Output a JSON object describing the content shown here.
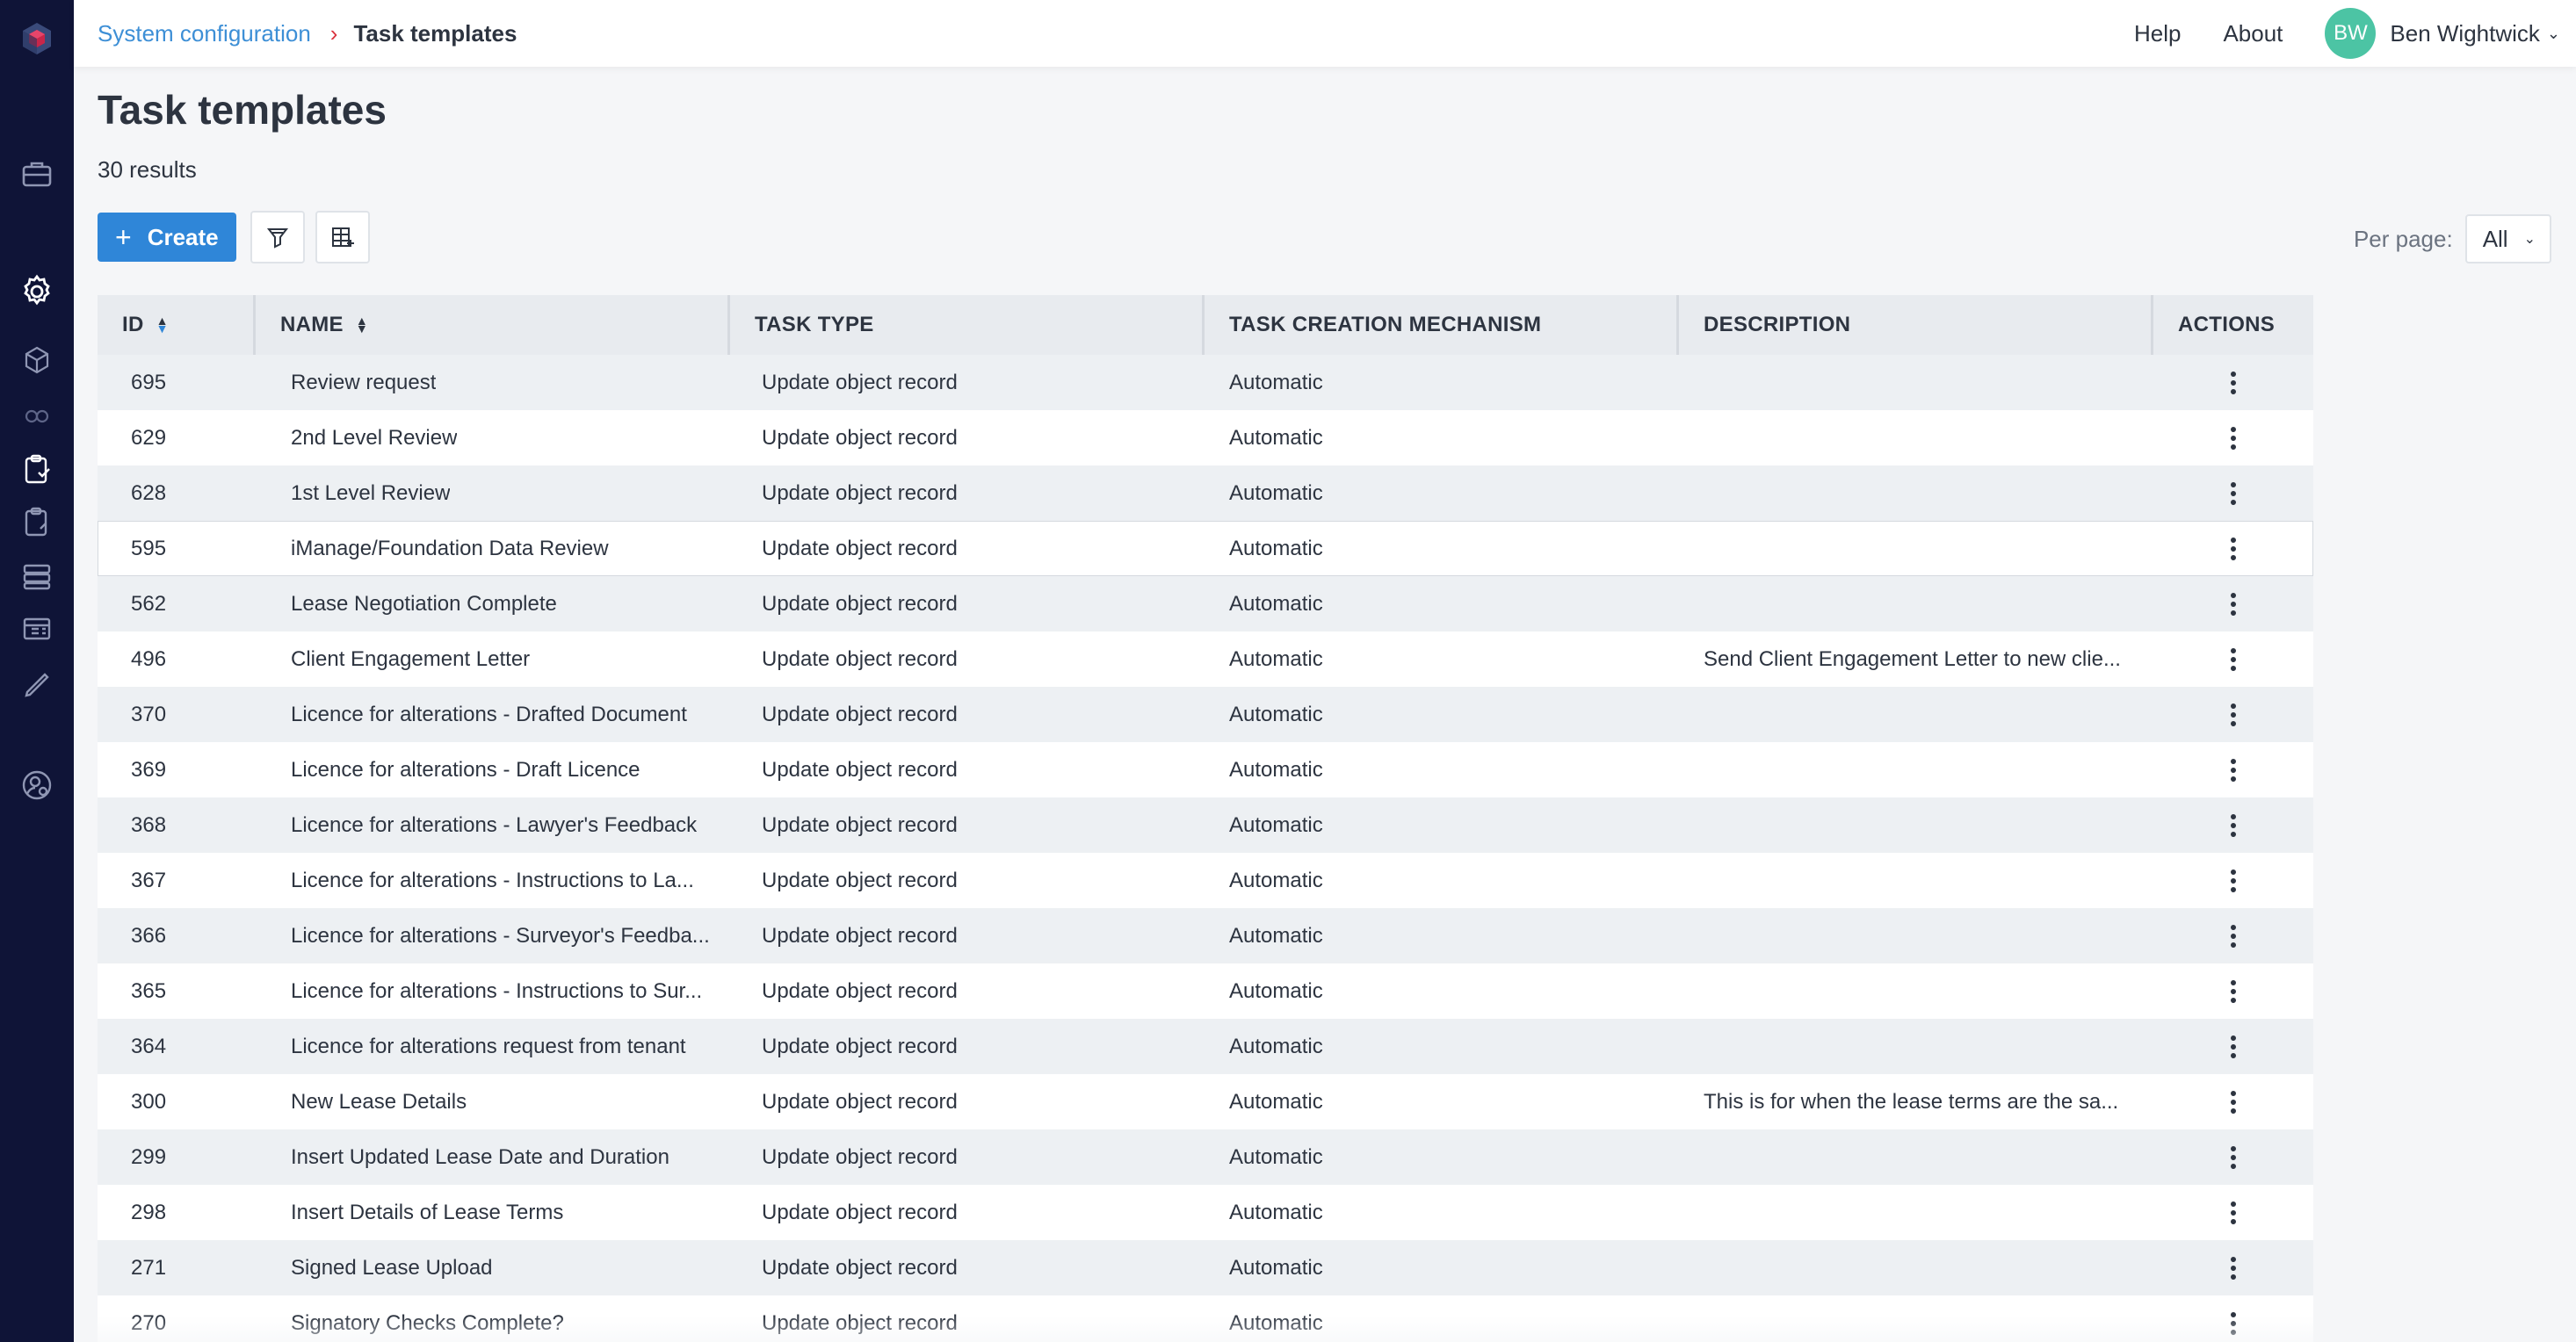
{
  "breadcrumb": {
    "parent": "System configuration",
    "current": "Task templates"
  },
  "header": {
    "help": "Help",
    "about": "About",
    "user_initials": "BW",
    "user_name": "Ben Wightwick"
  },
  "page": {
    "title": "Task templates",
    "results": "30 results"
  },
  "toolbar": {
    "create_label": "Create"
  },
  "per_page": {
    "label": "Per page:",
    "value": "All"
  },
  "table": {
    "columns": [
      "ID",
      "NAME",
      "TASK TYPE",
      "TASK CREATION MECHANISM",
      "DESCRIPTION",
      "ACTIONS"
    ],
    "rows": [
      {
        "id": "695",
        "name": "Review request",
        "type": "Update object record",
        "mech": "Automatic",
        "desc": ""
      },
      {
        "id": "629",
        "name": "2nd Level Review",
        "type": "Update object record",
        "mech": "Automatic",
        "desc": ""
      },
      {
        "id": "628",
        "name": "1st Level Review",
        "type": "Update object record",
        "mech": "Automatic",
        "desc": ""
      },
      {
        "id": "595",
        "name": "iManage/Foundation Data Review",
        "type": "Update object record",
        "mech": "Automatic",
        "desc": ""
      },
      {
        "id": "562",
        "name": "Lease Negotiation Complete",
        "type": "Update object record",
        "mech": "Automatic",
        "desc": ""
      },
      {
        "id": "496",
        "name": "Client Engagement Letter",
        "type": "Update object record",
        "mech": "Automatic",
        "desc": "Send Client Engagement Letter to new clie..."
      },
      {
        "id": "370",
        "name": "Licence for alterations - Drafted Document",
        "type": "Update object record",
        "mech": "Automatic",
        "desc": ""
      },
      {
        "id": "369",
        "name": "Licence for alterations - Draft Licence",
        "type": "Update object record",
        "mech": "Automatic",
        "desc": ""
      },
      {
        "id": "368",
        "name": "Licence for alterations - Lawyer's Feedback",
        "type": "Update object record",
        "mech": "Automatic",
        "desc": ""
      },
      {
        "id": "367",
        "name": "Licence for alterations - Instructions to La...",
        "type": "Update object record",
        "mech": "Automatic",
        "desc": ""
      },
      {
        "id": "366",
        "name": "Licence for alterations - Surveyor's Feedba...",
        "type": "Update object record",
        "mech": "Automatic",
        "desc": ""
      },
      {
        "id": "365",
        "name": "Licence for alterations - Instructions to Sur...",
        "type": "Update object record",
        "mech": "Automatic",
        "desc": ""
      },
      {
        "id": "364",
        "name": "Licence for alterations request from tenant",
        "type": "Update object record",
        "mech": "Automatic",
        "desc": ""
      },
      {
        "id": "300",
        "name": "New Lease Details",
        "type": "Update object record",
        "mech": "Automatic",
        "desc": "This is for when the lease terms are the sa..."
      },
      {
        "id": "299",
        "name": "Insert Updated Lease Date and Duration",
        "type": "Update object record",
        "mech": "Automatic",
        "desc": ""
      },
      {
        "id": "298",
        "name": "Insert Details of Lease Terms",
        "type": "Update object record",
        "mech": "Automatic",
        "desc": ""
      },
      {
        "id": "271",
        "name": "Signed Lease Upload",
        "type": "Update object record",
        "mech": "Automatic",
        "desc": ""
      },
      {
        "id": "270",
        "name": "Signatory Checks Complete?",
        "type": "Update object record",
        "mech": "Automatic",
        "desc": ""
      }
    ]
  },
  "nav_icons": [
    "app-logo-icon",
    "briefcase-icon",
    "settings-gear-icon",
    "cube-icon",
    "link-icon",
    "clipboard-task-icon",
    "clipboard-icon",
    "server-stack-icon",
    "table-icon",
    "pen-icon",
    "user-settings-icon"
  ],
  "colors": {
    "accent": "#2f86d8",
    "rail": "#0f1437",
    "avatar": "#4cc4a4",
    "crumb_sep": "#d9343f"
  }
}
